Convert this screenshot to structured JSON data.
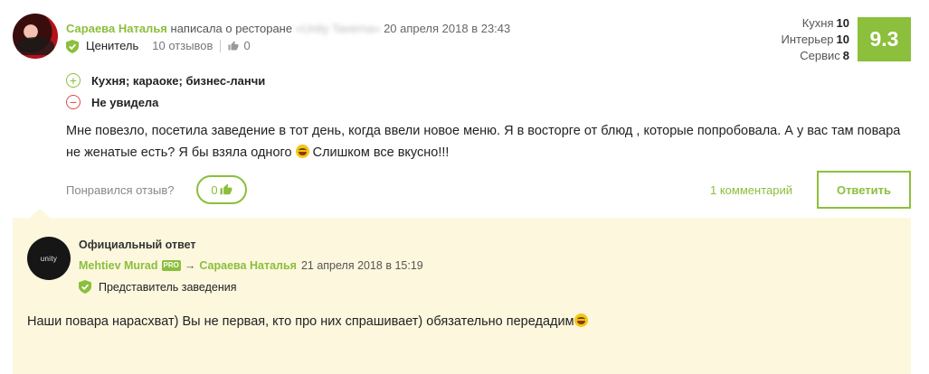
{
  "review": {
    "author_name": "Сараева Наталья",
    "wrote_label": "написала о ресторане",
    "restaurant_name": "«Unity Taverna»",
    "date": "20 апреля 2018 в 23:43",
    "rank": "Ценитель",
    "reviews_count": "10 отзывов",
    "likes_count": "0",
    "scores": [
      {
        "label": "Кухня",
        "value": "10"
      },
      {
        "label": "Интерьер",
        "value": "10"
      },
      {
        "label": "Сервис",
        "value": "8"
      }
    ],
    "overall_score": "9.3",
    "pros": "Кухня; караоке; бизнес-ланчи",
    "cons": "Не увидела",
    "text_part1": "Мне повезло, посетила заведение в тот день, когда ввели новое меню. Я в восторге от блюд , которые попробовала. А у вас там повара не женатые есть? Я бы взяла одного ",
    "text_part2": " Слишком все вкусно!!!",
    "liked_question": "Понравился отзыв?",
    "like_button_count": "0",
    "comments_link": "1 комментарий",
    "reply_button": "Ответить"
  },
  "official_reply": {
    "title": "Официальный ответ",
    "avatar_text": "unity",
    "author": "Mehtiev Murad",
    "pro_badge": "PRO",
    "arrow": "→",
    "to_name": "Сараева Наталья",
    "date": "21 апреля 2018 в 15:19",
    "role": "Представитель заведения",
    "text": "Наши повара нарасхват) Вы не первая, кто про них спрашивает) обязательно передадим"
  },
  "colors": {
    "accent": "#8bbf3c",
    "negative": "#e04a4a",
    "reply_background": "#fdf7de"
  },
  "icons": [
    "shield-check-icon",
    "thumbs-up-icon",
    "plus-circle-icon",
    "minus-circle-icon",
    "laughing-emoji-icon"
  ]
}
